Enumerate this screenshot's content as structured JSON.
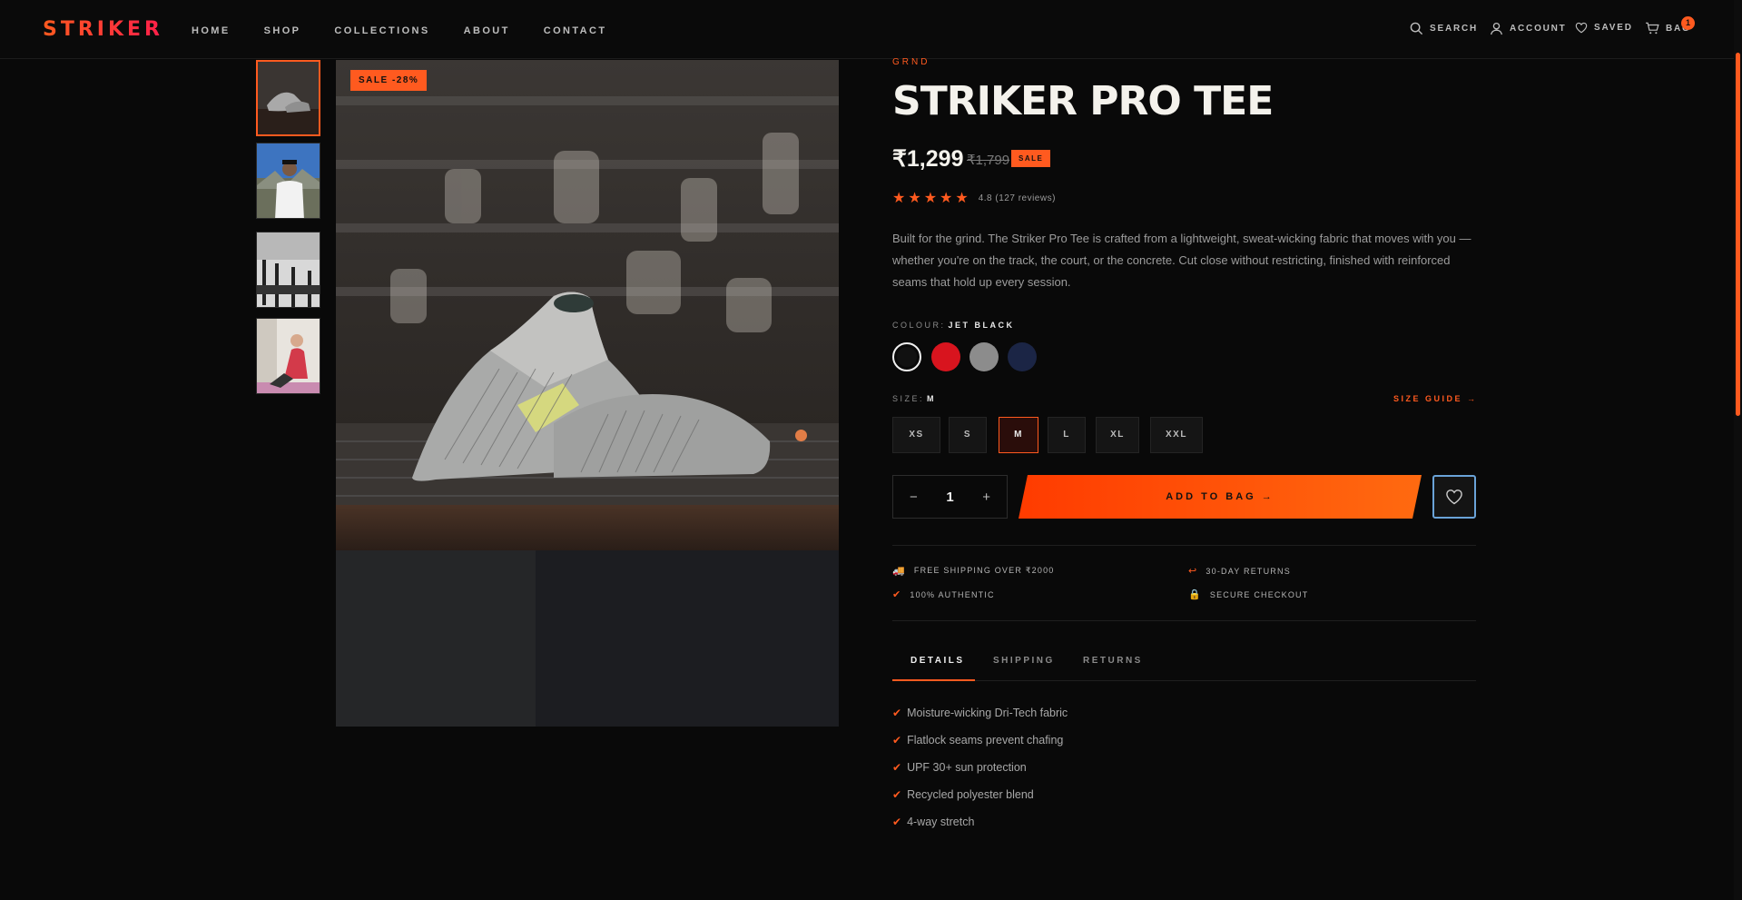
{
  "brand_logo": "STRIKER",
  "nav": [
    "HOME",
    "SHOP",
    "COLLECTIONS",
    "ABOUT",
    "CONTACT"
  ],
  "utility": {
    "search": "SEARCH",
    "account": "ACCOUNT",
    "saved": "SAVED",
    "bag": "BAG",
    "bag_count": "1"
  },
  "gallery": {
    "sale_badge": "SALE -28%"
  },
  "product": {
    "brand": "GRND",
    "title": "STRIKER PRO TEE",
    "price": "₹1,299",
    "old_price": "₹1,799",
    "sale_pill": "SALE",
    "rating_text": "4.8 (127 reviews)",
    "rating_value": 4.8,
    "description": "Built for the grind. The Striker Pro Tee is crafted from a lightweight, sweat-wicking fabric that moves with you — whether you're on the track, the court, or the concrete. Cut close without restricting, finished with reinforced seams that hold up every session."
  },
  "colour": {
    "label": "COLOUR:",
    "selected": "JET BLACK",
    "swatches": [
      "#111111",
      "#d8141e",
      "#8c8c8c",
      "#1b2545"
    ]
  },
  "size": {
    "label": "SIZE:",
    "selected": "M",
    "options": [
      "XS",
      "S",
      "M",
      "L",
      "XL",
      "XXL"
    ],
    "guide": "SIZE GUIDE →"
  },
  "purchase": {
    "minus": "−",
    "qty": "1",
    "plus": "+",
    "add_to_bag": "ADD TO BAG →"
  },
  "features": [
    {
      "icon": "🚚",
      "text": "FREE SHIPPING OVER ₹2000"
    },
    {
      "icon": "↩",
      "text": "30-DAY RETURNS"
    },
    {
      "icon": "✔",
      "text": "100% AUTHENTIC"
    },
    {
      "icon": "🔒",
      "text": "SECURE CHECKOUT"
    }
  ],
  "tabs": [
    "DETAILS",
    "SHIPPING",
    "RETURNS"
  ],
  "details": [
    "Moisture-wicking Dri-Tech fabric",
    "Flatlock seams prevent chafing",
    "UPF 30+ sun protection",
    "Recycled polyester blend",
    "4-way stretch"
  ]
}
